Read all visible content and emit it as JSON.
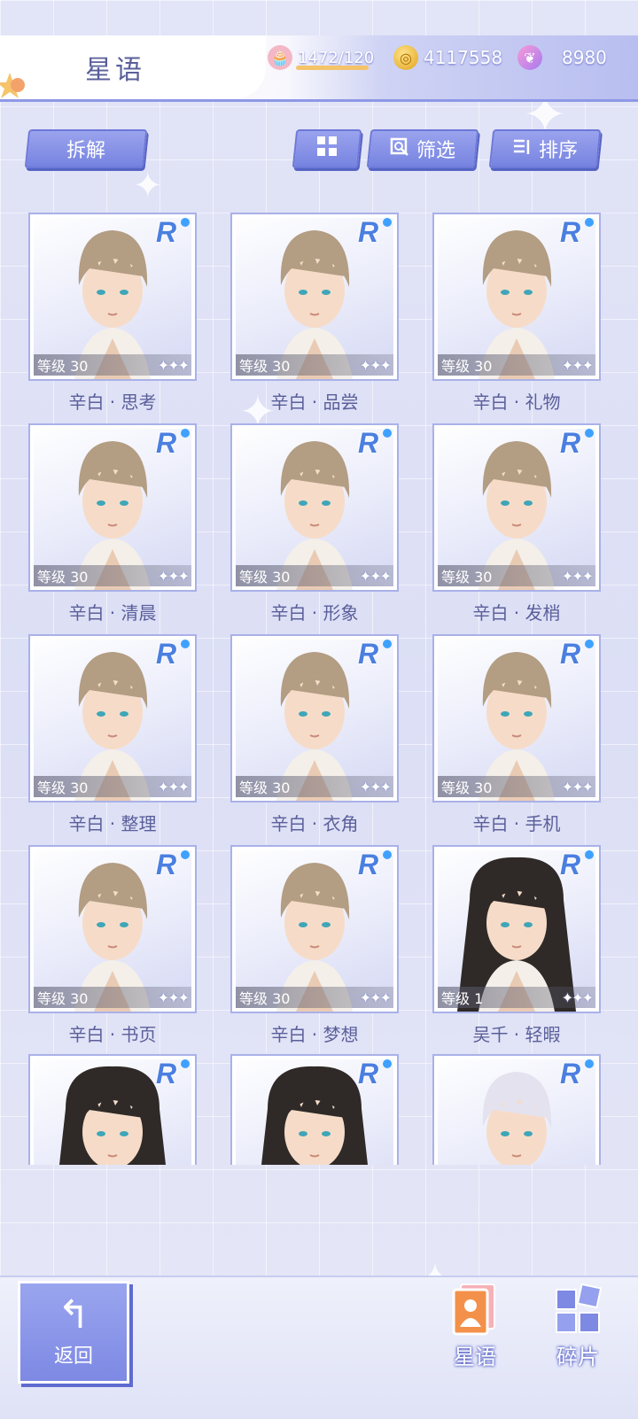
{
  "header": {
    "title": "星语",
    "resources": [
      {
        "icon": "cake-stamina-icon",
        "value": "1472/120"
      },
      {
        "icon": "gold-coin-icon",
        "value": "4117558"
      },
      {
        "icon": "pink-swan-gem-icon",
        "value": "8980"
      }
    ]
  },
  "toolbar": {
    "dismantle_label": "拆解",
    "grid_view_icon": "grid-view-icon",
    "filter_label": "筛选",
    "sort_label": "排序"
  },
  "cards": [
    {
      "rarity": "R",
      "level": "等级 30",
      "name": "辛白 · 思考",
      "hair": "#b39d83"
    },
    {
      "rarity": "R",
      "level": "等级 30",
      "name": "辛白 · 品尝",
      "hair": "#b39d83"
    },
    {
      "rarity": "R",
      "level": "等级 30",
      "name": "辛白 · 礼物",
      "hair": "#b39d83"
    },
    {
      "rarity": "R",
      "level": "等级 30",
      "name": "辛白 · 清晨",
      "hair": "#b39d83"
    },
    {
      "rarity": "R",
      "level": "等级 30",
      "name": "辛白 · 形象",
      "hair": "#b39d83"
    },
    {
      "rarity": "R",
      "level": "等级 30",
      "name": "辛白 · 发梢",
      "hair": "#b39d83"
    },
    {
      "rarity": "R",
      "level": "等级 30",
      "name": "辛白 · 整理",
      "hair": "#b39d83"
    },
    {
      "rarity": "R",
      "level": "等级 30",
      "name": "辛白 · 衣角",
      "hair": "#b39d83"
    },
    {
      "rarity": "R",
      "level": "等级 30",
      "name": "辛白 · 手机",
      "hair": "#b39d83"
    },
    {
      "rarity": "R",
      "level": "等级 30",
      "name": "辛白 · 书页",
      "hair": "#b39d83"
    },
    {
      "rarity": "R",
      "level": "等级 30",
      "name": "辛白 · 梦想",
      "hair": "#b39d83"
    },
    {
      "rarity": "R",
      "level": "等级 1",
      "name": "吴千 · 轻暇",
      "hair": "#2f2a28"
    },
    {
      "rarity": "R",
      "level": "",
      "name": "",
      "hair": "#2f2a28"
    },
    {
      "rarity": "R",
      "level": "",
      "name": "",
      "hair": "#2f2a28"
    },
    {
      "rarity": "R",
      "level": "",
      "name": "",
      "hair": "#e4e2ee"
    }
  ],
  "stars_text": "✦✦✦",
  "bottom_nav": {
    "back_label": "返回",
    "cards_label": "星语",
    "fragments_label": "碎片"
  }
}
